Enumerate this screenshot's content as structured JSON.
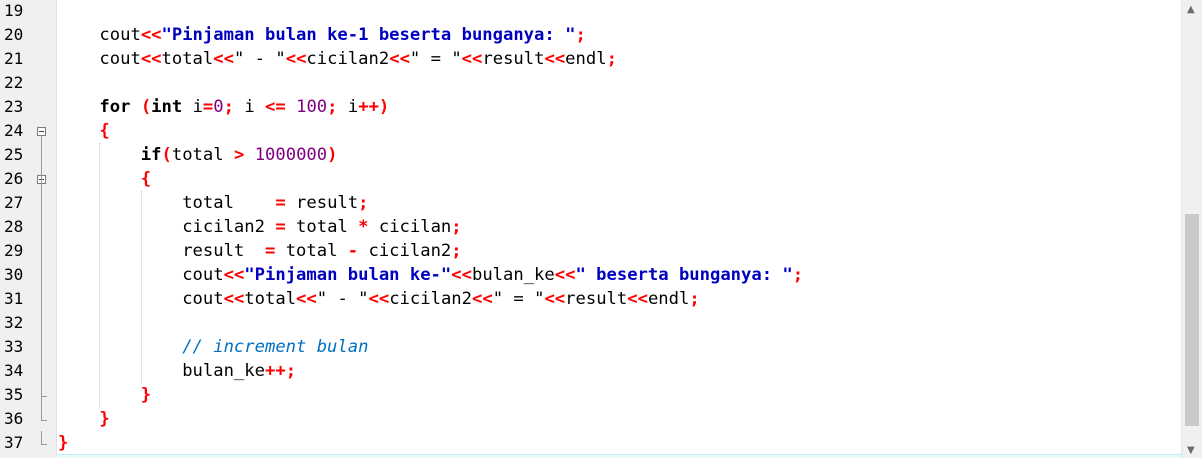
{
  "editor": {
    "language": "C++",
    "lines": [
      {
        "n": "19",
        "tokens": []
      },
      {
        "n": "20",
        "tokens": [
          [
            "",
            "    "
          ],
          [
            "kw",
            "cout"
          ],
          [
            "op",
            "<<"
          ],
          [
            "str",
            "\"Pinjaman bulan ke-1 beserta bunganya: \""
          ],
          [
            "op",
            ";"
          ]
        ]
      },
      {
        "n": "21",
        "tokens": [
          [
            "",
            "    "
          ],
          [
            "kw",
            "cout"
          ],
          [
            "op",
            "<<"
          ],
          [
            "id",
            "total"
          ],
          [
            "op",
            "<<"
          ],
          [
            "",
            "\" - \""
          ],
          [
            "op",
            "<<"
          ],
          [
            "id",
            "cicilan2"
          ],
          [
            "op",
            "<<"
          ],
          [
            "",
            "\" = \""
          ],
          [
            "op",
            "<<"
          ],
          [
            "id",
            "result"
          ],
          [
            "op",
            "<<"
          ],
          [
            "id",
            "endl"
          ],
          [
            "op",
            ";"
          ]
        ]
      },
      {
        "n": "22",
        "tokens": []
      },
      {
        "n": "23",
        "tokens": [
          [
            "",
            "    "
          ],
          [
            "kwb",
            "for"
          ],
          [
            "",
            " "
          ],
          [
            "op",
            "("
          ],
          [
            "kwb",
            "int"
          ],
          [
            "",
            " i"
          ],
          [
            "op",
            "="
          ],
          [
            "num",
            "0"
          ],
          [
            "op",
            ";"
          ],
          [
            "",
            " i "
          ],
          [
            "op",
            "<="
          ],
          [
            "",
            " "
          ],
          [
            "num",
            "100"
          ],
          [
            "op",
            ";"
          ],
          [
            "",
            " i"
          ],
          [
            "op",
            "++"
          ],
          [
            "op",
            ")"
          ]
        ]
      },
      {
        "n": "24",
        "tokens": [
          [
            "",
            "    "
          ],
          [
            "op",
            "{"
          ]
        ],
        "fold": "open"
      },
      {
        "n": "25",
        "tokens": [
          [
            "",
            "        "
          ],
          [
            "kwb",
            "if"
          ],
          [
            "op",
            "("
          ],
          [
            "id",
            "total"
          ],
          [
            "",
            " "
          ],
          [
            "op",
            ">"
          ],
          [
            "",
            " "
          ],
          [
            "num",
            "1000000"
          ],
          [
            "op",
            ")"
          ]
        ]
      },
      {
        "n": "26",
        "tokens": [
          [
            "",
            "        "
          ],
          [
            "op",
            "{"
          ]
        ],
        "fold": "open"
      },
      {
        "n": "27",
        "tokens": [
          [
            "",
            "            "
          ],
          [
            "id",
            "total"
          ],
          [
            "",
            "    "
          ],
          [
            "op",
            "="
          ],
          [
            "",
            " result"
          ],
          [
            "op",
            ";"
          ]
        ]
      },
      {
        "n": "28",
        "tokens": [
          [
            "",
            "            "
          ],
          [
            "id",
            "cicilan2"
          ],
          [
            "",
            " "
          ],
          [
            "op",
            "="
          ],
          [
            "",
            " total "
          ],
          [
            "op",
            "*"
          ],
          [
            "",
            " cicilan"
          ],
          [
            "op",
            ";"
          ]
        ]
      },
      {
        "n": "29",
        "tokens": [
          [
            "",
            "            "
          ],
          [
            "id",
            "result"
          ],
          [
            "",
            "  "
          ],
          [
            "op",
            "="
          ],
          [
            "",
            " total "
          ],
          [
            "op",
            "-"
          ],
          [
            "",
            " cicilan2"
          ],
          [
            "op",
            ";"
          ]
        ]
      },
      {
        "n": "30",
        "tokens": [
          [
            "",
            "            "
          ],
          [
            "kw",
            "cout"
          ],
          [
            "op",
            "<<"
          ],
          [
            "str",
            "\"Pinjaman bulan ke-\""
          ],
          [
            "op",
            "<<"
          ],
          [
            "id",
            "bulan_ke"
          ],
          [
            "op",
            "<<"
          ],
          [
            "str",
            "\" beserta bunganya: \""
          ],
          [
            "op",
            ";"
          ]
        ]
      },
      {
        "n": "31",
        "tokens": [
          [
            "",
            "            "
          ],
          [
            "kw",
            "cout"
          ],
          [
            "op",
            "<<"
          ],
          [
            "id",
            "total"
          ],
          [
            "op",
            "<<"
          ],
          [
            "",
            "\" - \""
          ],
          [
            "op",
            "<<"
          ],
          [
            "id",
            "cicilan2"
          ],
          [
            "op",
            "<<"
          ],
          [
            "",
            "\" = \""
          ],
          [
            "op",
            "<<"
          ],
          [
            "id",
            "result"
          ],
          [
            "op",
            "<<"
          ],
          [
            "id",
            "endl"
          ],
          [
            "op",
            ";"
          ]
        ]
      },
      {
        "n": "32",
        "tokens": []
      },
      {
        "n": "33",
        "tokens": [
          [
            "",
            "            "
          ],
          [
            "cm",
            "// increment bulan"
          ]
        ]
      },
      {
        "n": "34",
        "tokens": [
          [
            "",
            "            "
          ],
          [
            "id",
            "bulan_ke"
          ],
          [
            "op",
            "++"
          ],
          [
            "op",
            ";"
          ]
        ]
      },
      {
        "n": "35",
        "tokens": [
          [
            "",
            "        "
          ],
          [
            "op",
            "}"
          ]
        ],
        "fold": "end"
      },
      {
        "n": "36",
        "tokens": [
          [
            "",
            "    "
          ],
          [
            "op",
            "}"
          ]
        ],
        "fold": "end"
      },
      {
        "n": "37",
        "tokens": [
          [
            "op",
            "}"
          ]
        ],
        "fold": "last"
      }
    ]
  },
  "colors": {
    "keyword": "#000000",
    "keyword_bold": "#000000",
    "operator": "#ff0000",
    "string": "#0000c0",
    "number": "#800080",
    "comment": "#0070c0",
    "identifier": "#000000",
    "plain": "#000000"
  },
  "icons": {
    "fold_open": "fold-minus-icon",
    "fold_end": "fold-end-icon"
  }
}
